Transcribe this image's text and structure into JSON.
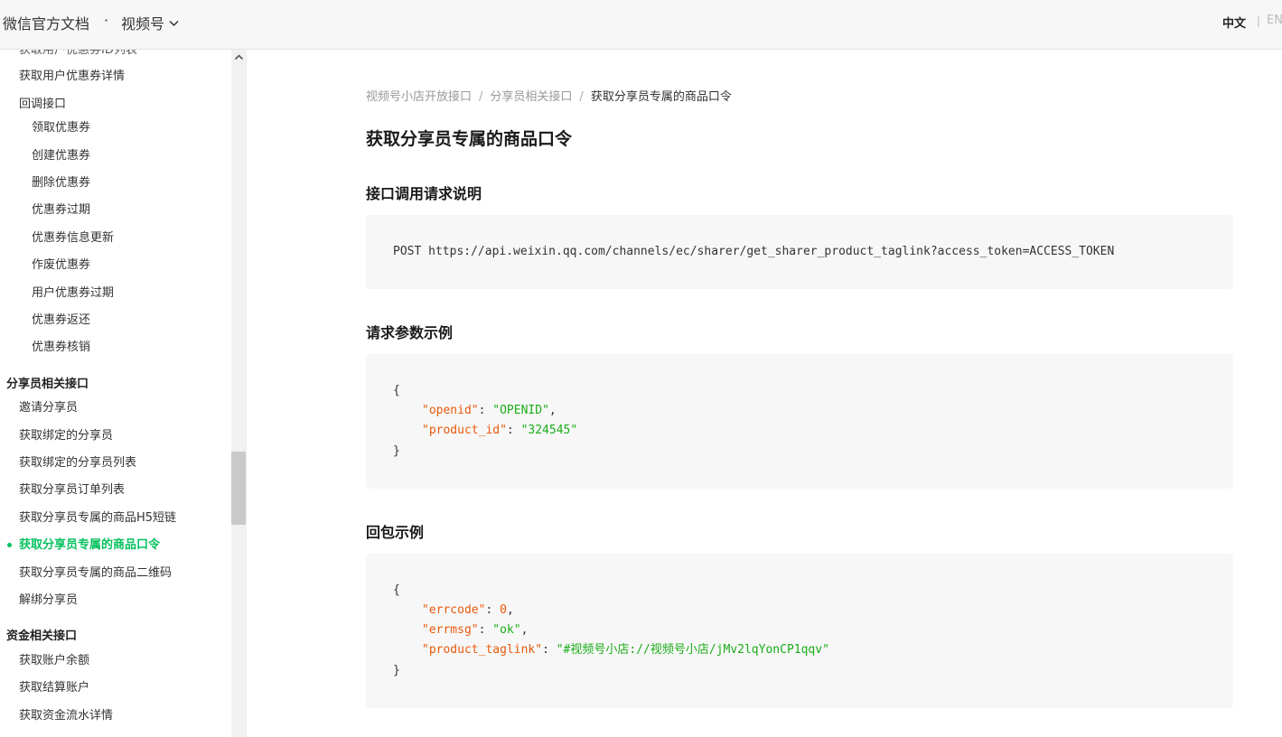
{
  "header": {
    "brand": "微信官方文档",
    "dot": "·",
    "channel": "视频号",
    "lang_zh": "中文",
    "lang_sep": "|",
    "lang_en": "EN"
  },
  "sidebar": {
    "cut_item": "获取用户优惠券ID列表",
    "coupon_items": [
      "获取用户优惠券详情",
      "回调接口"
    ],
    "callback_items": [
      "领取优惠券",
      "创建优惠券",
      "删除优惠券",
      "优惠券过期",
      "优惠券信息更新",
      "作废优惠券",
      "用户优惠券过期",
      "优惠券返还",
      "优惠券核销"
    ],
    "sharer_group": "分享员相关接口",
    "sharer_items": [
      "邀请分享员",
      "获取绑定的分享员",
      "获取绑定的分享员列表",
      "获取分享员订单列表",
      "获取分享员专属的商品H5短链",
      "获取分享员专属的商品口令",
      "获取分享员专属的商品二维码",
      "解绑分享员"
    ],
    "fund_group": "资金相关接口",
    "fund_items": [
      "获取账户余额",
      "获取结算账户",
      "获取资金流水详情"
    ]
  },
  "breadcrumb": [
    "视频号小店开放接口",
    "分享员相关接口",
    "获取分享员专属的商品口令"
  ],
  "breadcrumb_sep": "/",
  "page_title": "获取分享员专属的商品口令",
  "sections": {
    "request_title": "接口调用请求说明",
    "request_url": "POST https://api.weixin.qq.com/channels/ec/sharer/get_sharer_product_taglink?access_token=ACCESS_TOKEN",
    "params_title": "请求参数示例",
    "response_title": "回包示例"
  },
  "request_example": {
    "open": "{",
    "close": "}",
    "fields": [
      {
        "key": "\"openid\"",
        "colon": ": ",
        "value": "\"OPENID\"",
        "comma": ","
      },
      {
        "key": "\"product_id\"",
        "colon": ": ",
        "value": "\"324545\"",
        "comma": ""
      }
    ]
  },
  "response_example": {
    "open": "{",
    "close": "}",
    "fields": [
      {
        "key": "\"errcode\"",
        "colon": ": ",
        "value": "0",
        "comma": ","
      },
      {
        "key": "\"errmsg\"",
        "colon": ": ",
        "value": "\"ok\"",
        "comma": ","
      },
      {
        "key": "\"product_taglink\"",
        "colon": ": ",
        "value": "\"#视频号小店://视频号小店/jMv2lqYonCP1qqv\"",
        "comma": ""
      }
    ]
  },
  "colors": {
    "accent": "#07c160",
    "json_key": "#e8590c",
    "json_string": "#1aad19",
    "code_bg": "#f7f7f7"
  },
  "icons": {
    "channel_dropdown": "chevron-down-icon",
    "scroll_up": "triangle-up-icon"
  }
}
